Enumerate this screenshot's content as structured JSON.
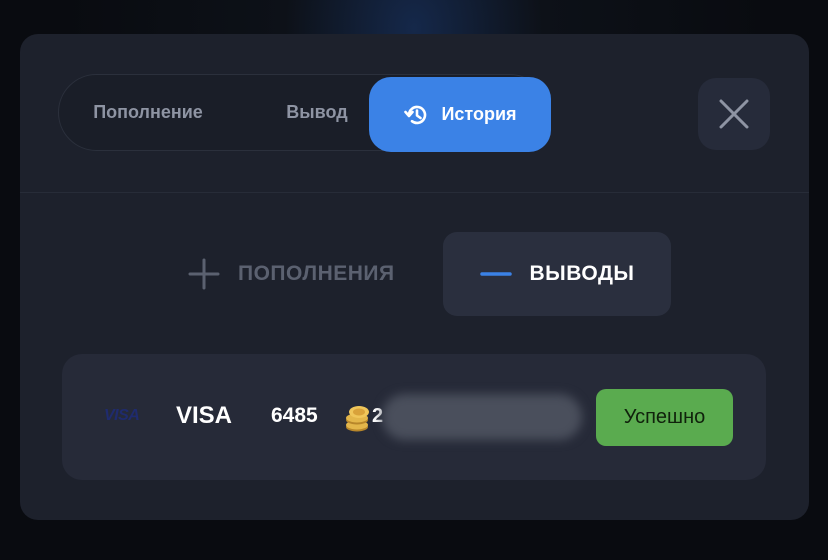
{
  "tabs": {
    "deposit_label": "Пополнение",
    "withdraw_label": "Вывод",
    "history_label": "История"
  },
  "filters": {
    "deposits_label": "ПОПОЛНЕНИЯ",
    "withdrawals_label": "ВЫВОДЫ"
  },
  "history": {
    "rows": [
      {
        "method_logo": "VISA",
        "method": "VISA",
        "amount": "6485",
        "coins_partial": "2",
        "status": "Успешно"
      }
    ]
  },
  "icons": {
    "history": "history-icon",
    "close": "close-icon",
    "plus": "plus-icon",
    "minus": "minus-icon",
    "coin": "coin-stack-icon"
  },
  "colors": {
    "accent": "#3b82e6",
    "success": "#5aab4f",
    "modal_bg": "#1d212c"
  }
}
